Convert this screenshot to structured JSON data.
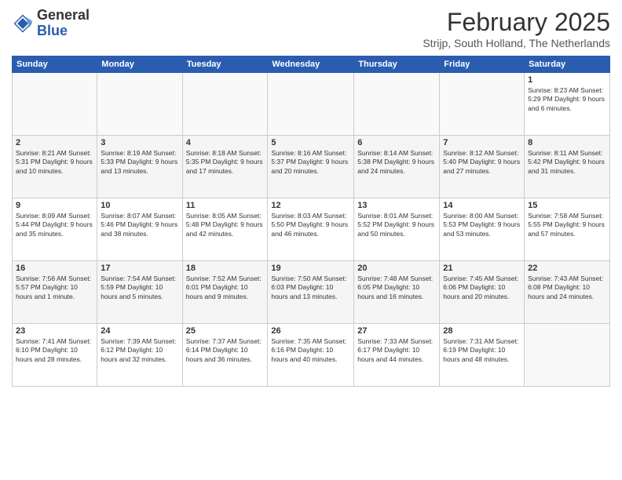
{
  "header": {
    "logo_line1": "General",
    "logo_line2": "Blue",
    "title": "February 2025",
    "location": "Strijp, South Holland, The Netherlands"
  },
  "days_of_week": [
    "Sunday",
    "Monday",
    "Tuesday",
    "Wednesday",
    "Thursday",
    "Friday",
    "Saturday"
  ],
  "weeks": [
    [
      {
        "day": "",
        "info": ""
      },
      {
        "day": "",
        "info": ""
      },
      {
        "day": "",
        "info": ""
      },
      {
        "day": "",
        "info": ""
      },
      {
        "day": "",
        "info": ""
      },
      {
        "day": "",
        "info": ""
      },
      {
        "day": "1",
        "info": "Sunrise: 8:23 AM\nSunset: 5:29 PM\nDaylight: 9 hours and 6 minutes."
      }
    ],
    [
      {
        "day": "2",
        "info": "Sunrise: 8:21 AM\nSunset: 5:31 PM\nDaylight: 9 hours and 10 minutes."
      },
      {
        "day": "3",
        "info": "Sunrise: 8:19 AM\nSunset: 5:33 PM\nDaylight: 9 hours and 13 minutes."
      },
      {
        "day": "4",
        "info": "Sunrise: 8:18 AM\nSunset: 5:35 PM\nDaylight: 9 hours and 17 minutes."
      },
      {
        "day": "5",
        "info": "Sunrise: 8:16 AM\nSunset: 5:37 PM\nDaylight: 9 hours and 20 minutes."
      },
      {
        "day": "6",
        "info": "Sunrise: 8:14 AM\nSunset: 5:38 PM\nDaylight: 9 hours and 24 minutes."
      },
      {
        "day": "7",
        "info": "Sunrise: 8:12 AM\nSunset: 5:40 PM\nDaylight: 9 hours and 27 minutes."
      },
      {
        "day": "8",
        "info": "Sunrise: 8:11 AM\nSunset: 5:42 PM\nDaylight: 9 hours and 31 minutes."
      }
    ],
    [
      {
        "day": "9",
        "info": "Sunrise: 8:09 AM\nSunset: 5:44 PM\nDaylight: 9 hours and 35 minutes."
      },
      {
        "day": "10",
        "info": "Sunrise: 8:07 AM\nSunset: 5:46 PM\nDaylight: 9 hours and 38 minutes."
      },
      {
        "day": "11",
        "info": "Sunrise: 8:05 AM\nSunset: 5:48 PM\nDaylight: 9 hours and 42 minutes."
      },
      {
        "day": "12",
        "info": "Sunrise: 8:03 AM\nSunset: 5:50 PM\nDaylight: 9 hours and 46 minutes."
      },
      {
        "day": "13",
        "info": "Sunrise: 8:01 AM\nSunset: 5:52 PM\nDaylight: 9 hours and 50 minutes."
      },
      {
        "day": "14",
        "info": "Sunrise: 8:00 AM\nSunset: 5:53 PM\nDaylight: 9 hours and 53 minutes."
      },
      {
        "day": "15",
        "info": "Sunrise: 7:58 AM\nSunset: 5:55 PM\nDaylight: 9 hours and 57 minutes."
      }
    ],
    [
      {
        "day": "16",
        "info": "Sunrise: 7:56 AM\nSunset: 5:57 PM\nDaylight: 10 hours and 1 minute."
      },
      {
        "day": "17",
        "info": "Sunrise: 7:54 AM\nSunset: 5:59 PM\nDaylight: 10 hours and 5 minutes."
      },
      {
        "day": "18",
        "info": "Sunrise: 7:52 AM\nSunset: 6:01 PM\nDaylight: 10 hours and 9 minutes."
      },
      {
        "day": "19",
        "info": "Sunrise: 7:50 AM\nSunset: 6:03 PM\nDaylight: 10 hours and 13 minutes."
      },
      {
        "day": "20",
        "info": "Sunrise: 7:48 AM\nSunset: 6:05 PM\nDaylight: 10 hours and 16 minutes."
      },
      {
        "day": "21",
        "info": "Sunrise: 7:45 AM\nSunset: 6:06 PM\nDaylight: 10 hours and 20 minutes."
      },
      {
        "day": "22",
        "info": "Sunrise: 7:43 AM\nSunset: 6:08 PM\nDaylight: 10 hours and 24 minutes."
      }
    ],
    [
      {
        "day": "23",
        "info": "Sunrise: 7:41 AM\nSunset: 6:10 PM\nDaylight: 10 hours and 28 minutes."
      },
      {
        "day": "24",
        "info": "Sunrise: 7:39 AM\nSunset: 6:12 PM\nDaylight: 10 hours and 32 minutes."
      },
      {
        "day": "25",
        "info": "Sunrise: 7:37 AM\nSunset: 6:14 PM\nDaylight: 10 hours and 36 minutes."
      },
      {
        "day": "26",
        "info": "Sunrise: 7:35 AM\nSunset: 6:16 PM\nDaylight: 10 hours and 40 minutes."
      },
      {
        "day": "27",
        "info": "Sunrise: 7:33 AM\nSunset: 6:17 PM\nDaylight: 10 hours and 44 minutes."
      },
      {
        "day": "28",
        "info": "Sunrise: 7:31 AM\nSunset: 6:19 PM\nDaylight: 10 hours and 48 minutes."
      },
      {
        "day": "",
        "info": ""
      }
    ]
  ]
}
